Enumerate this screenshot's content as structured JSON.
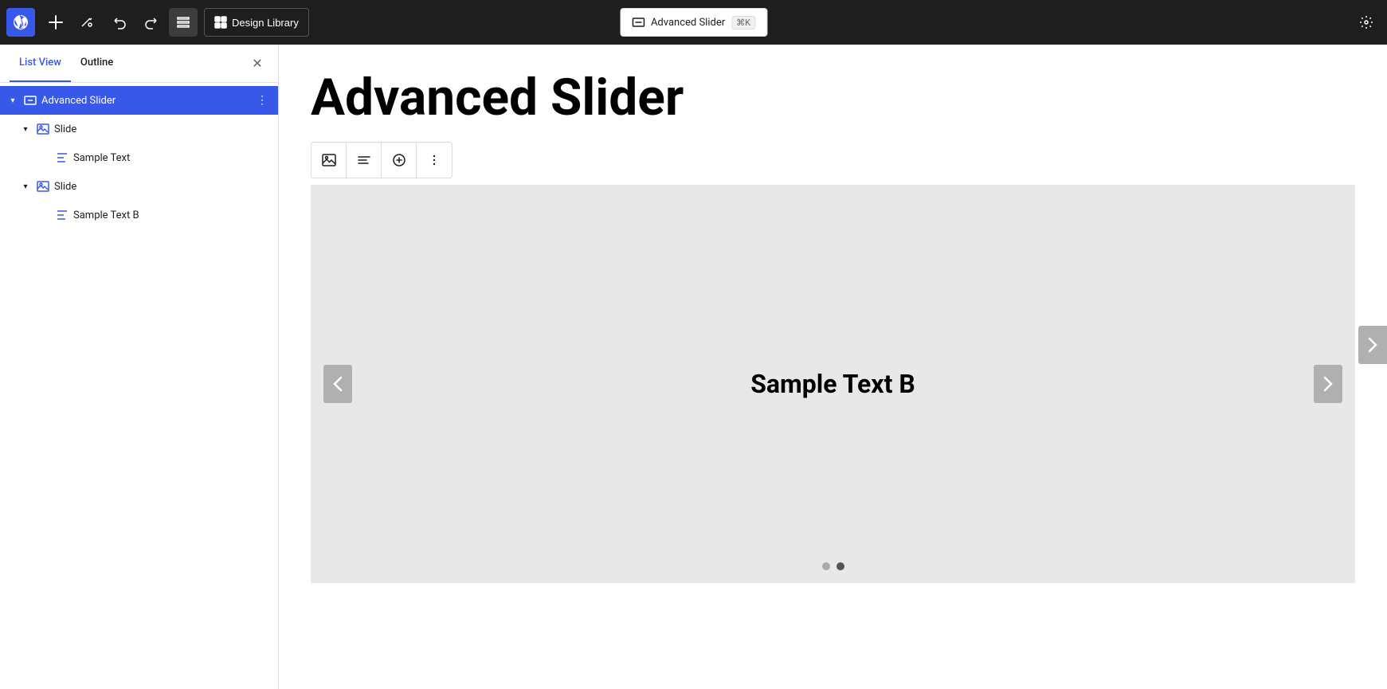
{
  "toolbar": {
    "design_library_label": "Design Library",
    "add_label": "+",
    "tools_label": "✎",
    "undo_label": "↺",
    "redo_label": "↻",
    "list_view_label": "≡"
  },
  "center_pill": {
    "label": "Advanced Slider",
    "shortcut": "⌘K"
  },
  "panel": {
    "tab_list_view": "List View",
    "tab_outline": "Outline",
    "close_label": "✕"
  },
  "tree": {
    "items": [
      {
        "id": "advanced-slider",
        "label": "Advanced Slider",
        "level": 0,
        "selected": true,
        "expanded": true,
        "has_chevron": true,
        "icon": "slider-icon"
      },
      {
        "id": "slide-1",
        "label": "Slide",
        "level": 1,
        "selected": false,
        "expanded": true,
        "has_chevron": true,
        "icon": "image-icon"
      },
      {
        "id": "sample-text-1",
        "label": "Sample Text",
        "level": 2,
        "selected": false,
        "expanded": false,
        "has_chevron": false,
        "icon": "heading-icon"
      },
      {
        "id": "slide-2",
        "label": "Slide",
        "level": 1,
        "selected": false,
        "expanded": true,
        "has_chevron": true,
        "icon": "image-icon"
      },
      {
        "id": "sample-text-b",
        "label": "Sample Text B",
        "level": 2,
        "selected": false,
        "expanded": false,
        "has_chevron": false,
        "icon": "heading-icon"
      }
    ]
  },
  "content": {
    "page_title": "Advanced Slider",
    "slider": {
      "current_text": "Sample Text B",
      "dots": [
        {
          "active": false
        },
        {
          "active": true
        }
      ]
    }
  },
  "block_toolbar": {
    "image_btn": "🖼",
    "align_btn": "≡",
    "add_btn": "+",
    "more_btn": "⋮"
  }
}
